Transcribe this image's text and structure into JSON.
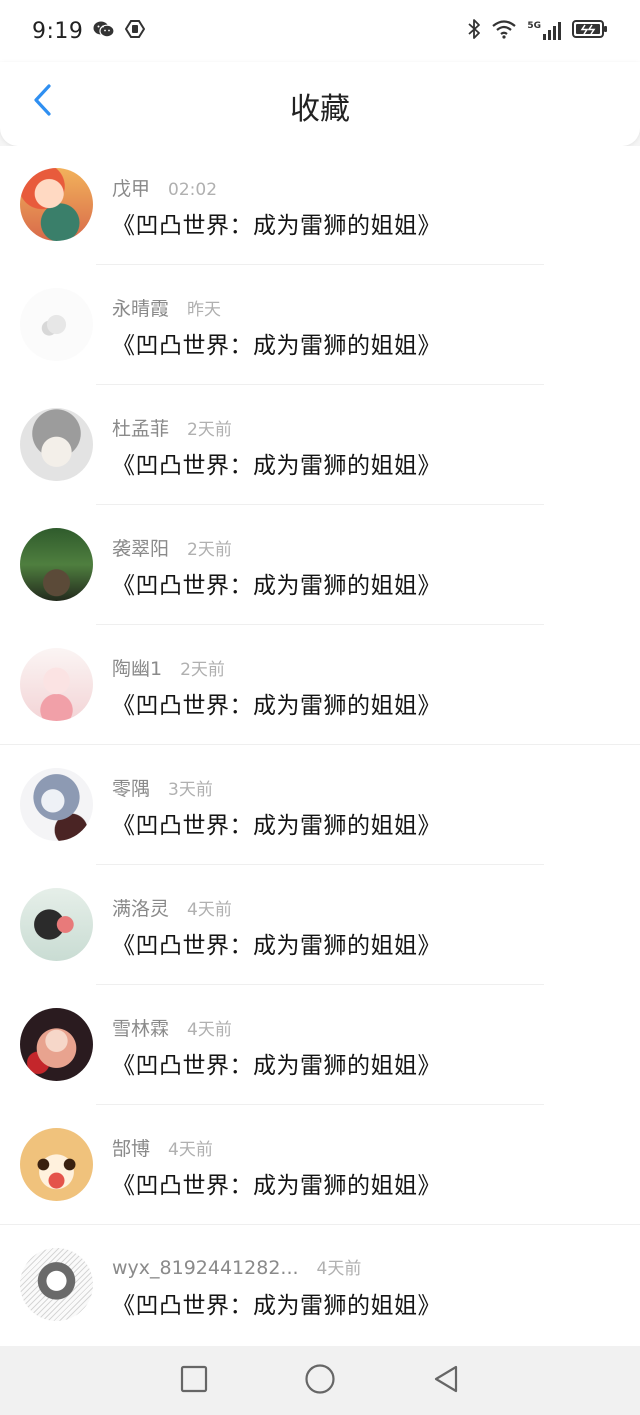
{
  "status_bar": {
    "time": "9:19",
    "network": "5G",
    "left_icons": [
      "wechat-icon",
      "shield-app-icon"
    ],
    "right_icons": [
      "bluetooth-icon",
      "wifi-icon",
      "signal-icon",
      "battery-icon"
    ]
  },
  "header": {
    "title": "收藏",
    "back_icon": "chevron-left-icon",
    "accent_color": "#2f8ff1"
  },
  "favorites": [
    {
      "name": "戊甲",
      "time": "02:02",
      "title": "《凹凸世界：成为雷狮的姐姐》",
      "avatar": "cartoon-girl-eating-avatar"
    },
    {
      "name": "永晴霞",
      "time": "昨天",
      "title": "《凹凸世界：成为雷狮的姐姐》",
      "avatar": "faded-white-avatar"
    },
    {
      "name": "杜孟菲",
      "time": "2天前",
      "title": "《凹凸世界：成为雷狮的姐姐》",
      "avatar": "gray-anime-girl-avatar"
    },
    {
      "name": "袭翠阳",
      "time": "2天前",
      "title": "《凹凸世界：成为雷狮的姐姐》",
      "avatar": "forest-scene-avatar"
    },
    {
      "name": "陶幽1",
      "time": "2天前",
      "title": "《凹凸世界：成为雷狮的姐姐》",
      "avatar": "pink-anime-fox-girl-avatar"
    },
    {
      "name": "零隅",
      "time": "3天前",
      "title": "《凹凸世界：成为雷狮的姐姐》",
      "avatar": "silver-hair-anime-avatar"
    },
    {
      "name": "满洛灵",
      "time": "4天前",
      "title": "《凹凸世界：成为雷狮的姐姐》",
      "avatar": "girl-with-flowers-avatar"
    },
    {
      "name": "雪林霖",
      "time": "4天前",
      "title": "《凹凸世界：成为雷狮的姐姐》",
      "avatar": "red-flower-anime-avatar"
    },
    {
      "name": "郜博",
      "time": "4天前",
      "title": "《凹凸世界：成为雷狮的姐姐》",
      "avatar": "cartoon-dog-face-avatar"
    },
    {
      "name": "wyx_8192441282...",
      "time": "4天前",
      "title": "《凹凸世界：成为雷狮的姐姐》",
      "avatar": "sketch-anime-avatar"
    }
  ],
  "nav_bar": {
    "icons": [
      "recent-apps-square-icon",
      "home-circle-icon",
      "back-triangle-icon"
    ]
  }
}
